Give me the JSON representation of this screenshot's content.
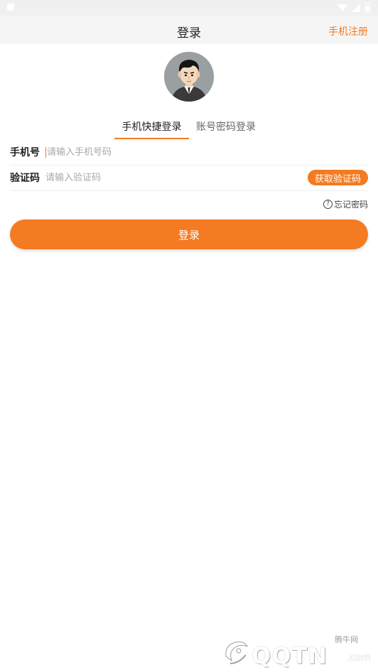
{
  "nav": {
    "title": "登录",
    "register_link": "手机注册"
  },
  "tabs": [
    {
      "label": "手机快捷登录",
      "active": true
    },
    {
      "label": "账号密码登录",
      "active": false
    }
  ],
  "form": {
    "phone_label": "手机号",
    "phone_placeholder": "请输入手机号码",
    "phone_value": "",
    "code_label": "验证码",
    "code_placeholder": "请输入验证码",
    "code_value": "",
    "get_code_button": "获取验证码"
  },
  "forgot_password": "忘记密码",
  "login_button": "登录",
  "watermark": {
    "brand": "腾牛网",
    "text": "QQTN",
    "suffix": ".com"
  },
  "colors": {
    "accent": "#f47b22",
    "nav_bg": "#f5f5f5",
    "avatar_bg": "#9aa0a2"
  },
  "icons": [
    "wifi-icon",
    "signal-icon",
    "battery-icon",
    "question-icon",
    "avatar"
  ]
}
